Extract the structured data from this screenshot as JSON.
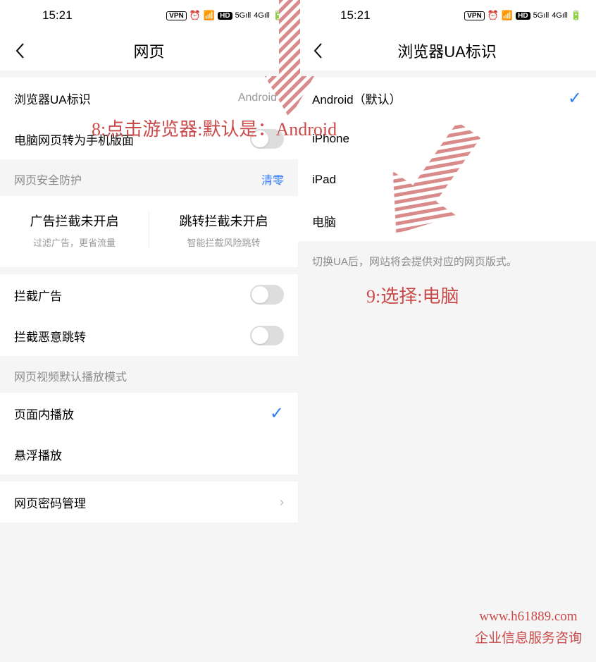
{
  "status": {
    "time": "15:21",
    "vpn": "VPN",
    "hd": "HD"
  },
  "left": {
    "title": "网页",
    "rows": {
      "ua": {
        "label": "浏览器UA标识",
        "value": "Android"
      },
      "desktop_to_mobile": {
        "label": "电脑网页转为手机版面"
      },
      "security_header": {
        "label": "网页安全防护",
        "action": "清零"
      },
      "ad_block_status": {
        "title": "广告拦截未开启",
        "sub": "过滤广告，更省流量"
      },
      "jump_block_status": {
        "title": "跳转拦截未开启",
        "sub": "智能拦截风险跳转"
      },
      "block_ads": {
        "label": "拦截广告"
      },
      "block_jump": {
        "label": "拦截恶意跳转"
      },
      "video_header": {
        "label": "网页视频默认播放模式"
      },
      "play_inline": {
        "label": "页面内播放"
      },
      "play_float": {
        "label": "悬浮播放"
      },
      "pwd_mgr": {
        "label": "网页密码管理"
      }
    }
  },
  "right": {
    "title": "浏览器UA标识",
    "options": {
      "android": "Android（默认）",
      "iphone": "iPhone",
      "ipad": "iPad",
      "pc": "电脑"
    },
    "note": "切换UA后，网站将会提供对应的网页版式。"
  },
  "annotations": {
    "a8": "8:点击游览器:默认是：Android",
    "a9": "9:选择:电脑"
  },
  "watermark": {
    "url": "www.h61889.com",
    "text": "企业信息服务咨询"
  }
}
